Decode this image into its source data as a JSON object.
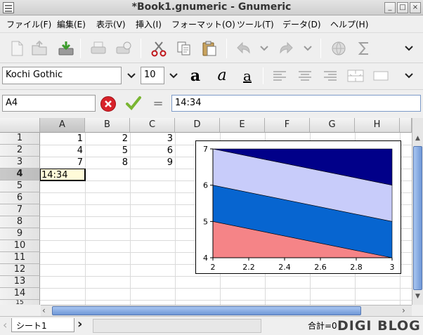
{
  "window": {
    "title": "*Book1.gnumeric - Gnumeric",
    "controls": [
      "_",
      "□",
      "×"
    ]
  },
  "menu": {
    "items": [
      "ファイル(F)",
      "編集(E)",
      "表示(V)",
      "挿入(I)",
      "フォーマット(O)",
      "ツール(T)",
      "データ(D)",
      "ヘルプ(H)"
    ]
  },
  "toolbar": {
    "icons": [
      "new-file-icon",
      "open-file-icon",
      "save-icon",
      "print-icon",
      "print-preview-icon",
      "cut-icon",
      "copy-icon",
      "paste-icon",
      "undo-icon",
      "undo-dropdown-icon",
      "redo-icon",
      "redo-dropdown-icon",
      "hyperlink-icon",
      "sum-icon",
      "toolbar-overflow-icon"
    ]
  },
  "format": {
    "font_name": "Kochi Gothic",
    "font_size": "10",
    "bold_glyph": "a",
    "italic_glyph": "a",
    "underline_glyph": "a"
  },
  "editline": {
    "cell_ref": "A4",
    "equals": "=",
    "formula": "14:34"
  },
  "grid": {
    "columns": [
      "A",
      "B",
      "C",
      "D",
      "E",
      "F",
      "G",
      "H"
    ],
    "selected_column": "A",
    "rows": [
      "1",
      "2",
      "3",
      "4",
      "5",
      "6",
      "7",
      "8",
      "9",
      "10",
      "11",
      "12",
      "13",
      "14",
      "15"
    ],
    "selected_row": "4",
    "cells": {
      "r1": [
        "1",
        "2",
        "3"
      ],
      "r2": [
        "4",
        "5",
        "6"
      ],
      "r3": [
        "7",
        "8",
        "9"
      ],
      "a4": "14:34"
    }
  },
  "chart_data": {
    "type": "area",
    "stacked": true,
    "x": [
      2,
      2.2,
      2.4,
      2.6,
      2.8,
      3
    ],
    "x_ticks": [
      "2",
      "2.2",
      "2.4",
      "2.6",
      "2.8",
      "3"
    ],
    "y_ticks": [
      "4",
      "5",
      "6",
      "7"
    ],
    "xlim": [
      2,
      3
    ],
    "ylim": [
      4,
      7
    ],
    "boundaries": {
      "x": [
        2,
        3
      ],
      "band1_top": [
        5,
        4
      ],
      "band2_top": [
        6,
        5
      ],
      "band3_top": [
        7,
        6
      ],
      "band4_top": [
        7,
        7
      ]
    },
    "colors": [
      "#f58487",
      "#0765d0",
      "#c8ccfa",
      "#010089"
    ],
    "title": "",
    "xlabel": "",
    "ylabel": ""
  },
  "statusbar": {
    "sheet_tab": "シート1",
    "sum": "合計=0",
    "watermark": "DIGI BLOG"
  }
}
